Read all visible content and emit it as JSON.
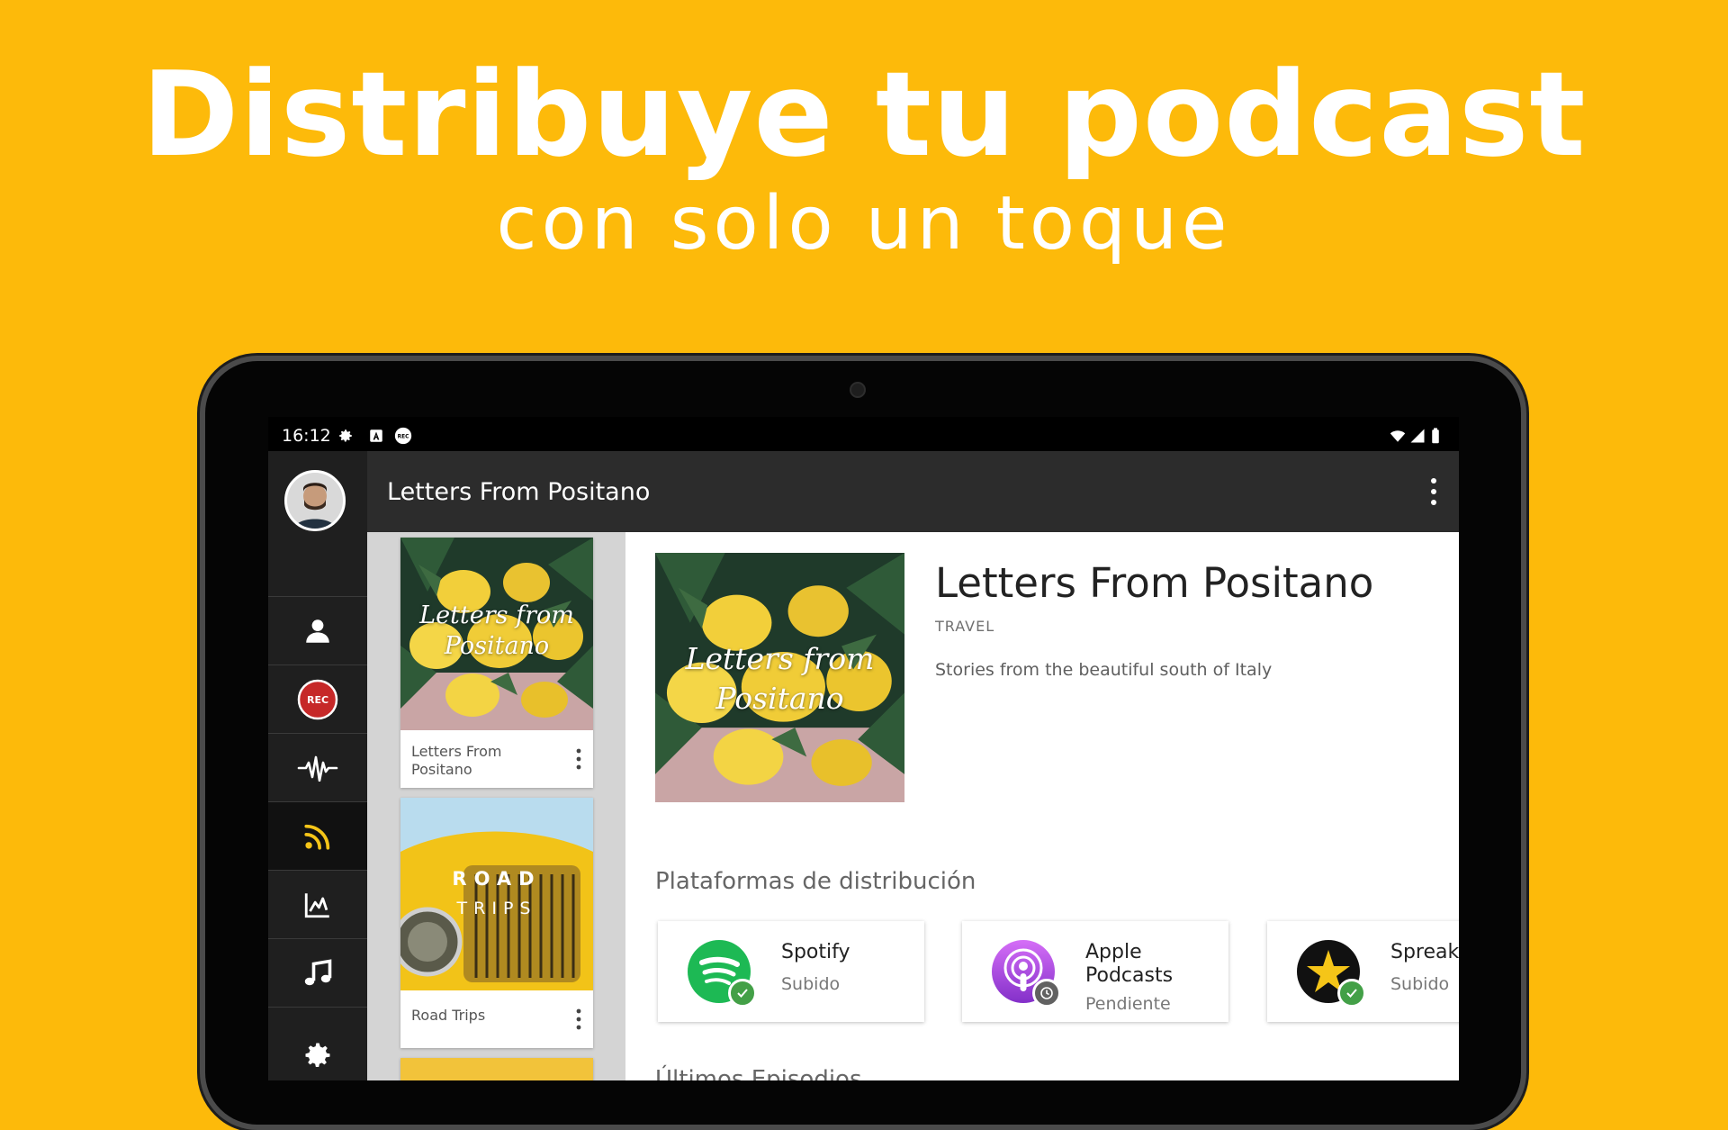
{
  "promo": {
    "headline": "Distribuye tu podcast",
    "subline": "con solo un toque",
    "background": "#FDBA0A"
  },
  "status_bar": {
    "time": "16:12",
    "icons_left": [
      "gear-icon",
      "a-icon",
      "rec-icon"
    ],
    "icons_right": [
      "wifi-icon",
      "signal-icon",
      "battery-icon"
    ],
    "rec_label": "REC"
  },
  "nav_rail": {
    "items": [
      {
        "name": "profile",
        "icon": "person-icon"
      },
      {
        "name": "record",
        "icon": "rec-icon",
        "label": "REC"
      },
      {
        "name": "audio",
        "icon": "waveform-icon"
      },
      {
        "name": "distribution",
        "icon": "rss-icon",
        "active": true
      },
      {
        "name": "stats",
        "icon": "chart-icon"
      },
      {
        "name": "music",
        "icon": "music-icon"
      },
      {
        "name": "settings",
        "icon": "gear-icon"
      }
    ],
    "accent": "#F5C518"
  },
  "app_bar": {
    "title": "Letters From Positano",
    "menu_icon": "more-vert-icon"
  },
  "podcast_list": {
    "items": [
      {
        "title": "Letters From Positano",
        "art_text": "Letters from Positano"
      },
      {
        "title": "Road Trips",
        "art_text_line1": "ROAD",
        "art_text_line2": "TRIPS"
      }
    ]
  },
  "detail": {
    "title": "Letters From Positano",
    "category": "TRAVEL",
    "description": "Stories from the beautiful south of Italy",
    "art_text": "Letters from Positano",
    "platforms_heading": "Plataformas de distribución",
    "platforms": [
      {
        "name": "Spotify",
        "status": "Subido",
        "state": "done",
        "color": "#1DB954"
      },
      {
        "name": "Apple Podcasts",
        "status": "Pendiente",
        "state": "pending",
        "color": "#9B3FD6"
      },
      {
        "name": "Spreaker",
        "status": "Subido",
        "state": "done",
        "color": "#F5C518"
      }
    ],
    "next_heading": "Últimos Episodios"
  }
}
